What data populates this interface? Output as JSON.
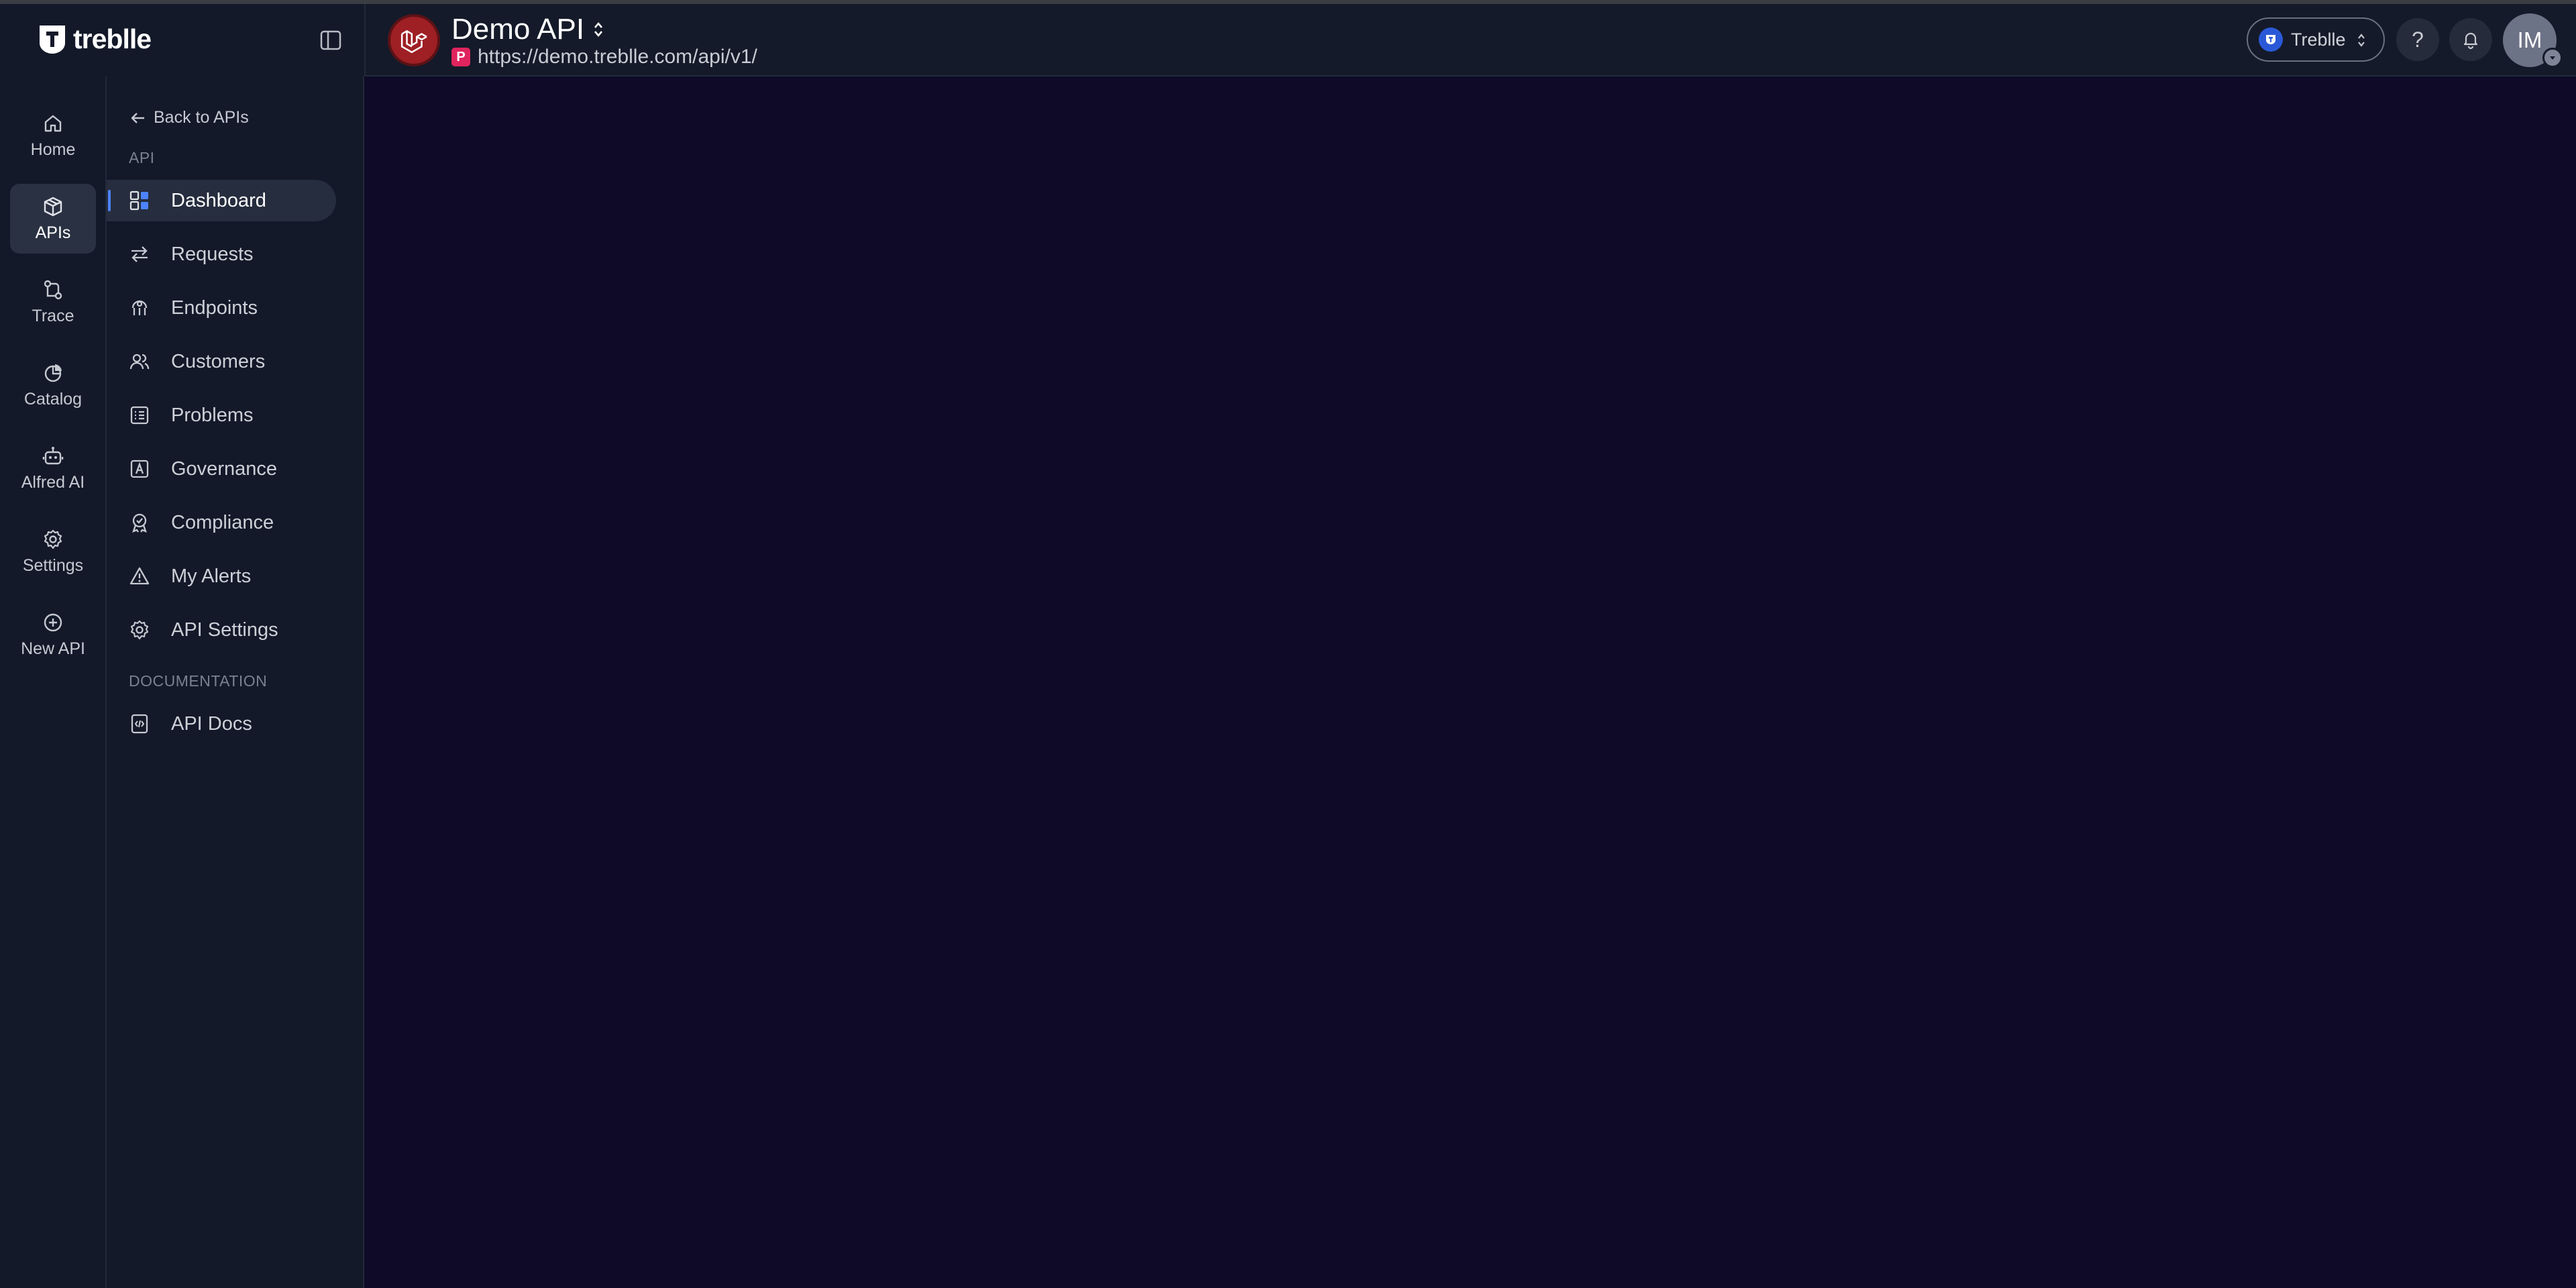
{
  "brand": {
    "name": "treblle"
  },
  "header": {
    "api_name": "Demo API",
    "env_badge": "P",
    "api_url": "https://demo.treblle.com/api/v1/",
    "workspace": "Treblle",
    "help_symbol": "?",
    "avatar_initials": "IM"
  },
  "rail": {
    "items": [
      {
        "label": "Home",
        "icon": "home-icon"
      },
      {
        "label": "APIs",
        "icon": "cube-icon"
      },
      {
        "label": "Trace",
        "icon": "trace-icon"
      },
      {
        "label": "Catalog",
        "icon": "catalog-icon"
      },
      {
        "label": "Alfred AI",
        "icon": "robot-icon"
      },
      {
        "label": "Settings",
        "icon": "gear-icon"
      },
      {
        "label": "New API",
        "icon": "plus-circle-icon"
      }
    ],
    "active": "APIs"
  },
  "subnav": {
    "back_label": "Back to APIs",
    "section_api": "API",
    "items": [
      {
        "label": "Dashboard",
        "icon": "dashboard-icon"
      },
      {
        "label": "Requests",
        "icon": "arrows-icon"
      },
      {
        "label": "Endpoints",
        "icon": "endpoints-icon"
      },
      {
        "label": "Customers",
        "icon": "users-icon"
      },
      {
        "label": "Problems",
        "icon": "list-icon"
      },
      {
        "label": "Governance",
        "icon": "governance-icon"
      },
      {
        "label": "Compliance",
        "icon": "badge-icon"
      },
      {
        "label": "My Alerts",
        "icon": "warning-icon"
      },
      {
        "label": "API Settings",
        "icon": "gear-icon"
      }
    ],
    "section_docs": "DOCUMENTATION",
    "docs_items": [
      {
        "label": "API Docs",
        "icon": "docs-icon"
      }
    ],
    "active": "Dashboard"
  },
  "colors": {
    "main_background": "#0f0a28",
    "sidebar_background": "#131929",
    "active_indicator": "#4c83ff",
    "api_badge": "#9e1f24",
    "env_badge": "#e0245e"
  }
}
